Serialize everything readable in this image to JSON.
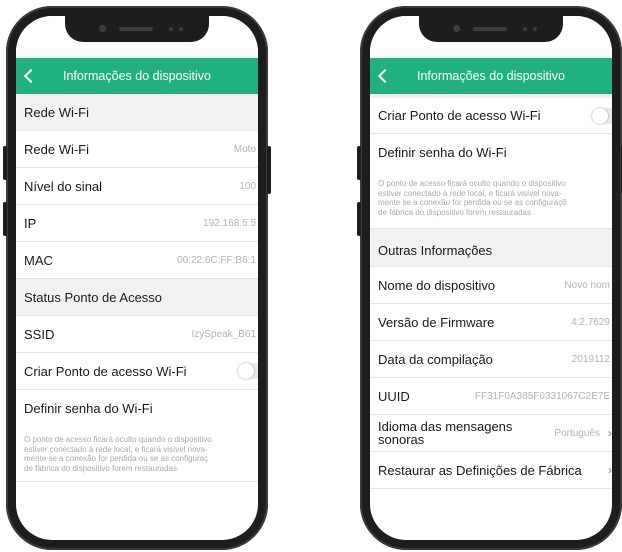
{
  "left_screen": {
    "app_bar": {
      "title": "Informações do dispositivo"
    },
    "sections": {
      "wifi_header": "Rede Wi-Fi",
      "wifi_network": {
        "label": "Rede Wi-Fi",
        "value": "Moto"
      },
      "signal_level": {
        "label": "Nível do sinal",
        "value": "100"
      },
      "ip": {
        "label": "IP",
        "value": "192.168.5.5"
      },
      "mac": {
        "label": "MAC",
        "value": "00:22:6C:FF:B6:1"
      },
      "hotspot_header": "Status Ponto de Acesso",
      "ssid": {
        "label": "SSID",
        "value": "IzySpeak_B61"
      },
      "create_hotspot": {
        "label": "Criar Ponto de acesso Wi-Fi",
        "enabled": false
      },
      "set_password": {
        "label": "Definir senha do Wi-Fi"
      },
      "note_lines": [
        "O ponto de acesso ficará oculto quando o dispositivo",
        "estiver conectado à rede local, e ficará visível nova-",
        "mente se a conexão for perdida ou se as configuraç",
        "de fábrica do dispositivo forem restauradas"
      ]
    }
  },
  "right_screen": {
    "app_bar": {
      "title": "Informações do dispositivo"
    },
    "sections": {
      "create_hotspot": {
        "label": "Criar Ponto de acesso Wi-Fi",
        "enabled": false
      },
      "set_password": {
        "label": "Definir senha do Wi-Fi"
      },
      "note_lines": [
        "O ponto de acesso ficará oculto quando o dispositivo",
        "estiver conectado à rede local, e ficará visível nova-",
        "mente se a conexão for perdida ou se as configuraçõ",
        "de fábrica do dispositivo forem restauradas"
      ],
      "other_header": "Outras Informações",
      "device_name": {
        "label": "Nome do dispositivo",
        "value": "Novo nom"
      },
      "firmware": {
        "label": "Versão de Firmware",
        "value": "4.2.7629"
      },
      "build_date": {
        "label": "Data da compilação",
        "value": "2019112"
      },
      "uuid": {
        "label": "UUID",
        "value": "FF31F0A385F0331067C2E7E"
      },
      "voice_language": {
        "label_line1": "Idioma das mensagens",
        "label_line2": "sonoras",
        "value": "Português"
      },
      "factory_reset": {
        "label": "Restaurar as Definições de Fábrica"
      }
    }
  },
  "colors": {
    "accent": "#21b17f",
    "section_bg": "#f2f2f2",
    "divider": "#e6e6e6"
  },
  "icons": {
    "back": "chevron-left-icon",
    "forward": "chevron-right-icon"
  }
}
